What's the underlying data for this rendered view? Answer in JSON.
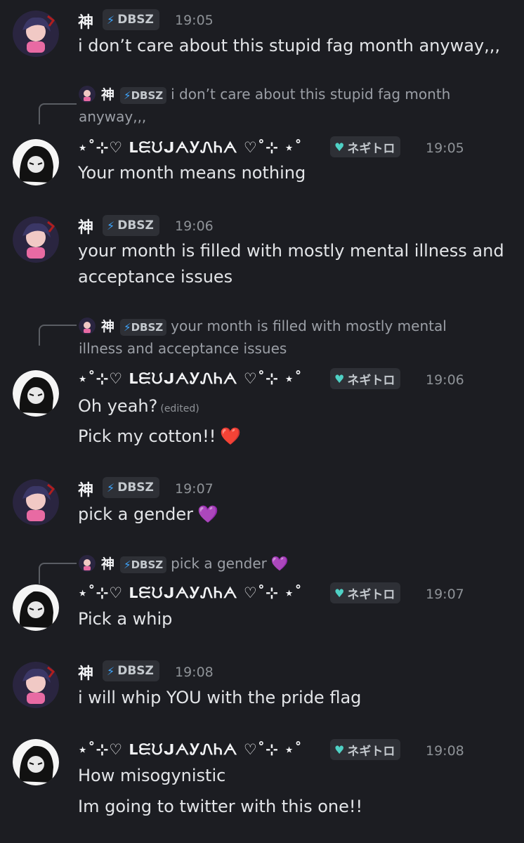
{
  "users": {
    "kami": {
      "name": "神",
      "tag": "DBSZ",
      "tag_icon": "lightning-bolt-icon"
    },
    "jay": {
      "name": "⋆˚⊹♡ ᒪᙓᙀᒍᗅᎩᏁᏂᗅ ♡˚⊹ ⋆˚",
      "tag": "ネギトロ",
      "tag_icon": "heart-badge-icon"
    }
  },
  "messages": [
    {
      "user": "kami",
      "time": "19:05",
      "lines": [
        "i don’t care about this stupid fag month anyway,,,"
      ]
    },
    {
      "user": "jay",
      "time": "19:05",
      "reply": {
        "user": "kami",
        "text": "i don’t care about this stupid fag month",
        "text2": "anyway,,,"
      },
      "lines": [
        "Your month means nothing"
      ]
    },
    {
      "user": "kami",
      "time": "19:06",
      "lines": [
        "your month is filled with mostly mental illness and",
        "acceptance issues"
      ]
    },
    {
      "user": "jay",
      "time": "19:06",
      "reply": {
        "user": "kami",
        "text": "your month is filled with mostly mental",
        "text2": "illness and acceptance issues"
      },
      "lines": [
        "Oh yeah?",
        "Pick my cotton!!"
      ],
      "edited": "(edited)",
      "emoji": "❤️"
    },
    {
      "user": "kami",
      "time": "19:07",
      "lines": [
        "pick a gender"
      ],
      "emoji": "💜"
    },
    {
      "user": "jay",
      "time": "19:07",
      "reply": {
        "user": "kami",
        "text": "pick a gender",
        "emoji": "💜"
      },
      "lines": [
        "Pick a whip"
      ]
    },
    {
      "user": "kami",
      "time": "19:08",
      "lines": [
        "i will whip YOU with the pride flag"
      ]
    },
    {
      "user": "jay",
      "time": "19:08",
      "lines": [
        "How misogynistic",
        "Im going to twitter with this one!!"
      ]
    }
  ],
  "colors": {
    "background": "#1c1d22",
    "tag_bg": "#2e3036",
    "bolt": "#3ea6ff",
    "heart_badge": "#4fd1c5"
  }
}
